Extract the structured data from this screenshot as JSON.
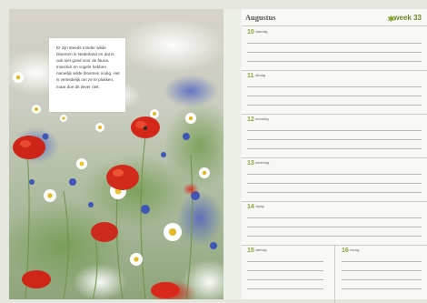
{
  "note": {
    "text": "Er zijn steeds minder wilde bloemen in Nederland en dat is ook niet goed voor de fauna. Insecten en vogels hebben namelijk wilde bloemen nodig. Het is verleidelijk om ze te plukken, maar doe dit liever niet."
  },
  "header": {
    "month": "Augustus",
    "week": "week 33",
    "icon": "leaf-icon"
  },
  "days": [
    {
      "num": "10",
      "name": "maandag"
    },
    {
      "num": "11",
      "name": "dinsdag"
    },
    {
      "num": "12",
      "name": "woensdag"
    },
    {
      "num": "13",
      "name": "donderdag"
    },
    {
      "num": "14",
      "name": "vrijdag"
    },
    {
      "num": "15",
      "name": "zaterdag"
    },
    {
      "num": "16",
      "name": "zondag"
    }
  ],
  "colors": {
    "accent": "#86a83a",
    "week": "#6b8a2a"
  }
}
